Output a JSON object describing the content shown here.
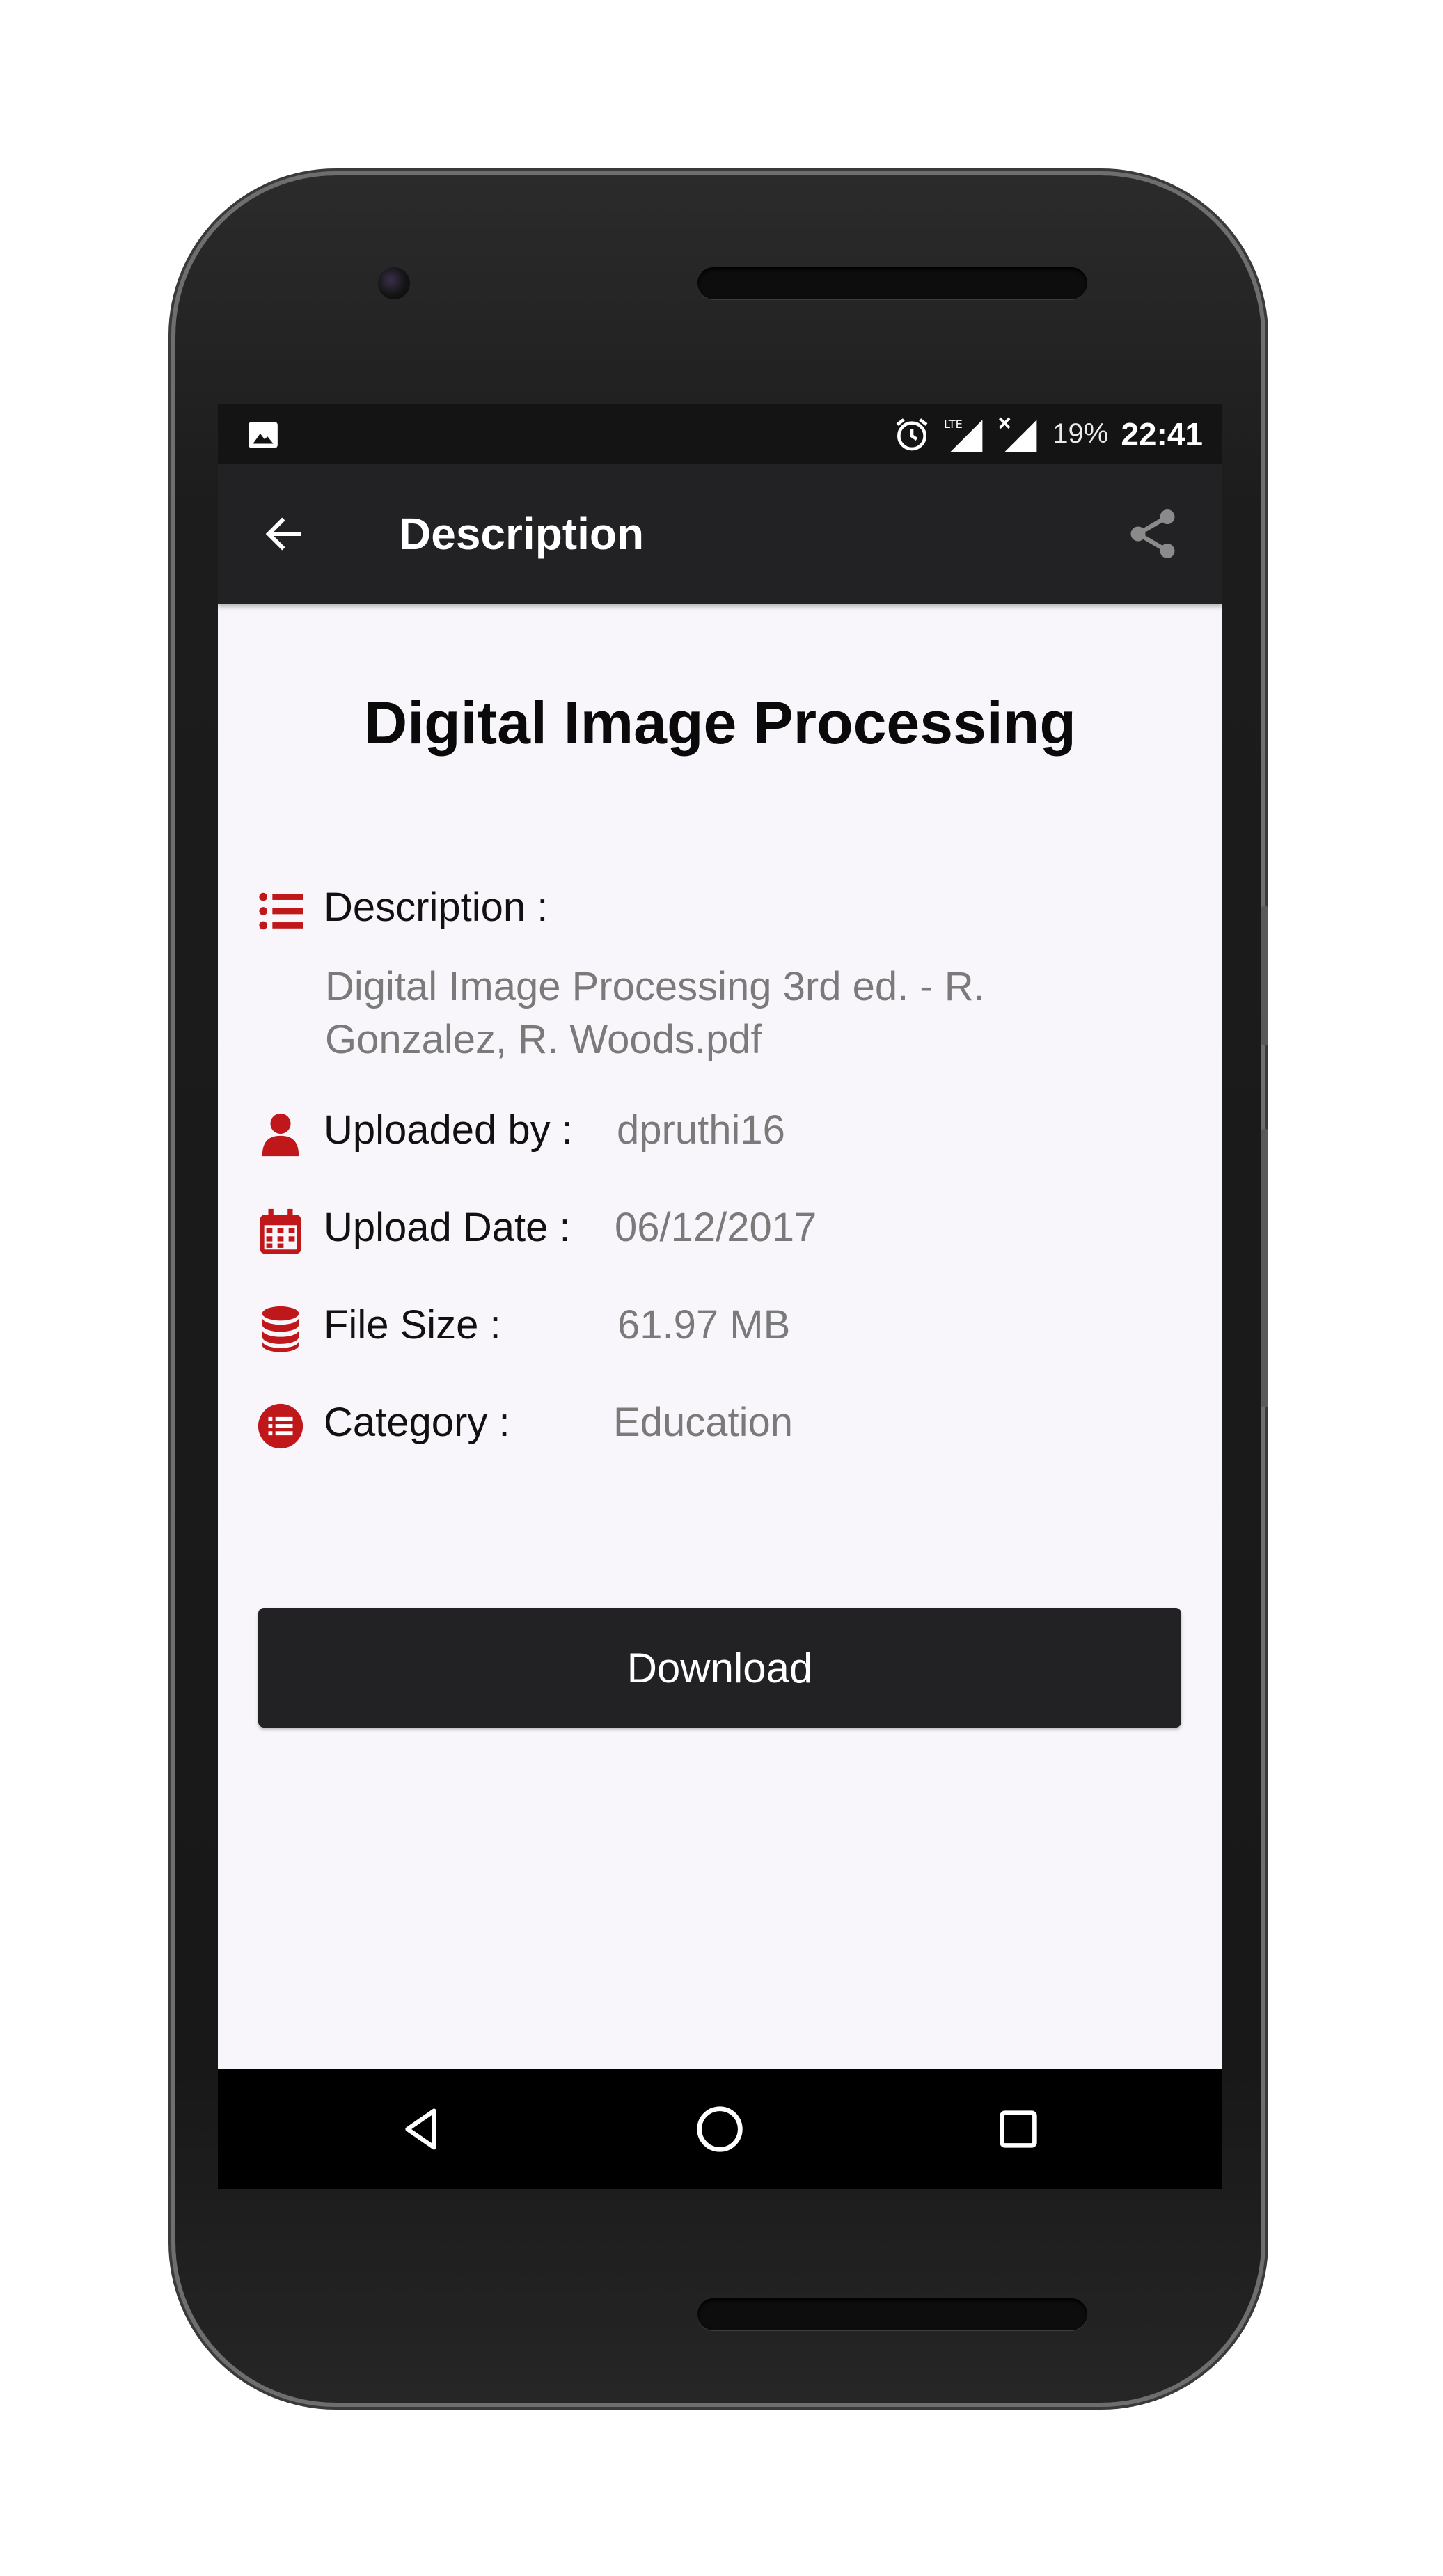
{
  "status_bar": {
    "battery": "19%",
    "time": "22:41",
    "icons": [
      "image-notification-icon",
      "alarm-icon",
      "lte-signal-icon",
      "no-sim-signal-icon"
    ]
  },
  "app_bar": {
    "title": "Description",
    "back_icon": "arrow-back-icon",
    "share_icon": "share-icon"
  },
  "book": {
    "title": "Digital Image Processing"
  },
  "details": {
    "description_label": "Description :",
    "description_line1": "Digital Image Processing 3rd ed. - R.",
    "description_line2": "Gonzalez, R. Woods.pdf",
    "uploaded_by_label": "Uploaded by :",
    "uploaded_by_value": "dpruthi16",
    "upload_date_label": "Upload Date :",
    "upload_date_value": "06/12/2017",
    "file_size_label": "File Size :",
    "file_size_value": "61.97 MB",
    "category_label": "Category :",
    "category_value": "Education"
  },
  "actions": {
    "download_label": "Download"
  },
  "nav_bar": {
    "icons": [
      "back-triangle-icon",
      "home-circle-icon",
      "recents-square-icon"
    ]
  },
  "colors": {
    "accent_red": "#c0171b",
    "app_bar": "#222124",
    "status_bar": "#141414",
    "screen_bg": "#f8f6fa",
    "value_gray": "#7a7a7a"
  }
}
